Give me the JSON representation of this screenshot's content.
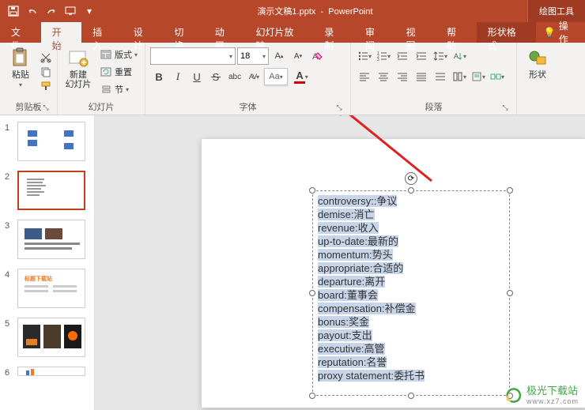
{
  "title": {
    "filename": "演示文稿1.pptx",
    "app": "PowerPoint",
    "contextual": "绘图工具"
  },
  "tabs": {
    "file": "文件",
    "home": "开始",
    "insert": "插入",
    "design": "设计",
    "transitions": "切换",
    "animations": "动画",
    "slideshow": "幻灯片放映",
    "record": "录制",
    "review": "审阅",
    "view": "视图",
    "help": "帮助",
    "shapeformat": "形状格式",
    "tell": "操作"
  },
  "ribbon": {
    "clipboard": {
      "paste": "粘贴",
      "label": "剪贴板"
    },
    "slides": {
      "new": "新建\n幻灯片",
      "layout": "版式",
      "reset": "重置",
      "section": "节",
      "label": "幻灯片"
    },
    "font": {
      "size": "18",
      "label": "字体"
    },
    "para": {
      "label": "段落"
    },
    "shape": "形状"
  },
  "thumbs": {
    "n1": "1",
    "n2": "2",
    "n3": "3",
    "n4": "4",
    "n5": "5",
    "n6": "6"
  },
  "slide_text": [
    "controversy::争议",
    "demise:消亡",
    "revenue:收入",
    "up-to-date:最新的",
    "momentum:势头",
    "appropriate:合适的",
    "departure:离开",
    "board:董事会",
    "compensation:补偿金",
    "bonus:奖金",
    "payout:支出",
    "executive:高管",
    "reputation:名誉",
    "proxy statement:委托书"
  ],
  "watermark": {
    "name": "极光下载站",
    "url": "www.xz7.com"
  }
}
